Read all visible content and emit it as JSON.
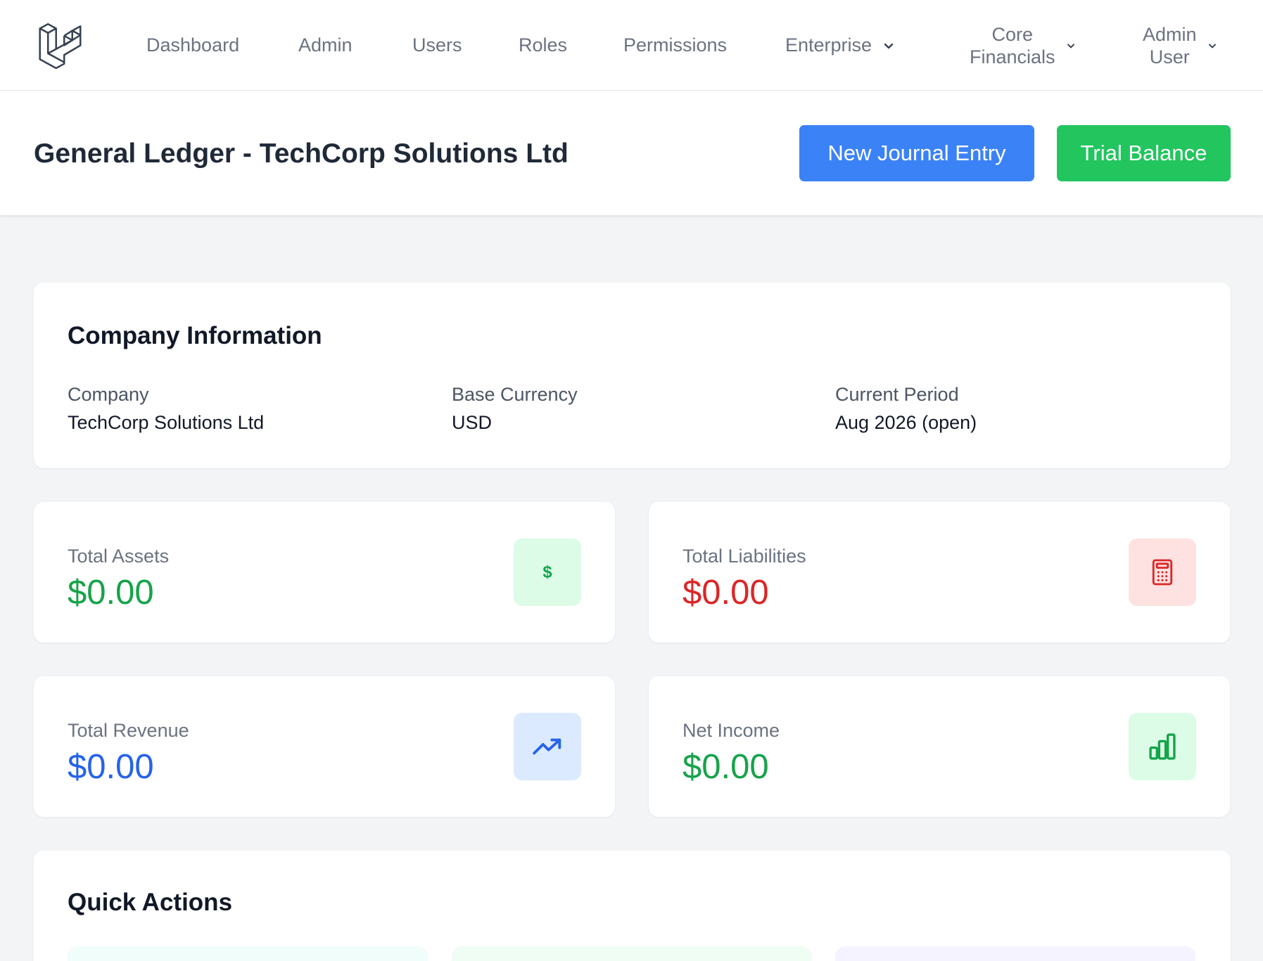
{
  "nav": {
    "links": [
      "Dashboard",
      "Admin",
      "Users",
      "Roles",
      "Permissions"
    ],
    "enterprise": "Enterprise",
    "core_line1": "Core",
    "core_line2": "Financials",
    "user_line1": "Admin",
    "user_line2": "User",
    "logo_icon": "laravel-logo",
    "chevron_icon": "chevron-down-icon"
  },
  "header": {
    "title": "General Ledger - TechCorp Solutions Ltd",
    "new_entry_label": "New Journal Entry",
    "trial_balance_label": "Trial Balance"
  },
  "company": {
    "heading": "Company Information",
    "fields": [
      {
        "label": "Company",
        "value": "TechCorp Solutions Ltd"
      },
      {
        "label": "Base Currency",
        "value": "USD"
      },
      {
        "label": "Current Period",
        "value": "Aug 2026 (open)"
      }
    ]
  },
  "stats": [
    {
      "label": "Total Assets",
      "value": "$0.00",
      "color": "#16a34a",
      "icon": "dollar-icon",
      "icon_bg": "#dcfce7",
      "icon_color": "#16a34a"
    },
    {
      "label": "Total Liabilities",
      "value": "$0.00",
      "color": "#dc2626",
      "icon": "calculator-icon",
      "icon_bg": "#fee2e2",
      "icon_color": "#dc2626"
    },
    {
      "label": "Total Revenue",
      "value": "$0.00",
      "color": "#2563eb",
      "icon": "trending-up-icon",
      "icon_bg": "#dbeafe",
      "icon_color": "#2563eb"
    },
    {
      "label": "Net Income",
      "value": "$0.00",
      "color": "#16a34a",
      "icon": "bar-chart-icon",
      "icon_bg": "#dcfce7",
      "icon_color": "#16a34a"
    }
  ],
  "quick_actions": {
    "heading": "Quick Actions"
  },
  "colors": {
    "primary": "#3b82f6",
    "success": "#22c55e",
    "page_bg": "#f3f4f6"
  }
}
